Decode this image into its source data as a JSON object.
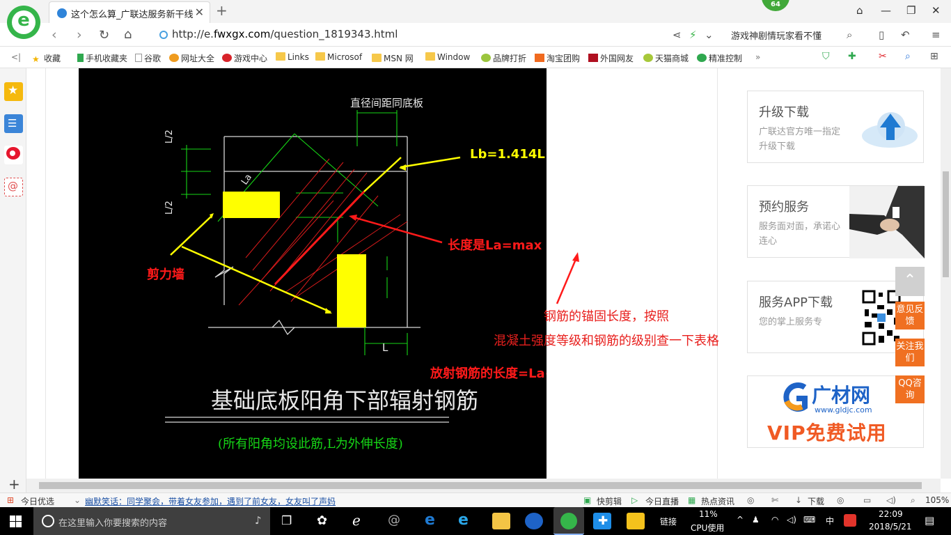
{
  "browser": {
    "tab_title": "这个怎么算_广联达服务新干线",
    "badge_count": "64",
    "url_prefix": "http://e.",
    "url_domain": "fwxgx.com",
    "url_path": "/question_1819343.html",
    "search_hint": "游戏神剧情玩家看不懂",
    "bookmarks": [
      "收藏",
      "手机收藏夹",
      "谷歌",
      "网址大全",
      "游戏中心",
      "Links",
      "Microsof",
      "MSN 网",
      "Window",
      "品牌打折",
      "淘宝团购",
      "外国网友",
      "天猫商城",
      "精准控制"
    ],
    "more": "»"
  },
  "figure": {
    "top_label": "直径间距同底板",
    "l_half_1": "L/2",
    "l_half_2": "L/2",
    "la_label": "La",
    "l_label": "L",
    "main_title": "基础底板阳角下部辐射钢筋",
    "sub_title": "(所有阳角均设此筋,L为外伸长度)",
    "lb_annot": "Lb=1.414L",
    "la_annot": "长度是La=max [L,La]",
    "wall_annot": "剪力墙",
    "anchor_note_1": "钢筋的锚固长度，按照",
    "anchor_note_2": "混凝土强度等级和钢筋的级别查一下表格",
    "formula": "放射钢筋的长度=La+Lb="
  },
  "sidebar_cards": [
    {
      "title": "升级下载",
      "sub": "广联达官方唯一指定升级下载"
    },
    {
      "title": "预约服务",
      "sub": "服务面对面，承诺心连心"
    },
    {
      "title": "服务APP下载",
      "sub": "您的掌上服务专"
    },
    {
      "logo_text": "广材网",
      "logo_url": "www.gldjc.com",
      "vip": "VIP免费试用"
    }
  ],
  "float_buttons": [
    "意见反馈",
    "关注我们",
    "QQ咨询"
  ],
  "status": {
    "today": "今日优选",
    "news": "幽默笑话：同学聚会，带着女友参加，遇到了前女友，女友叫了声妈",
    "quick_cut": "快剪辑",
    "live": "今日直播",
    "hot": "热点资讯",
    "download": "下载",
    "zoom": "105%"
  },
  "taskbar": {
    "search_placeholder": "在这里输入你要搜索的内容",
    "link": "链接",
    "cpu_pct": "11%",
    "cpu_label": "CPU使用",
    "ime": "中",
    "time": "22:09",
    "date": "2018/5/21"
  },
  "colors": {
    "accent_green": "#35b54a",
    "float_orange": "#f07021",
    "annot_red": "#e8201e",
    "annot_yellow": "#ffff00"
  }
}
